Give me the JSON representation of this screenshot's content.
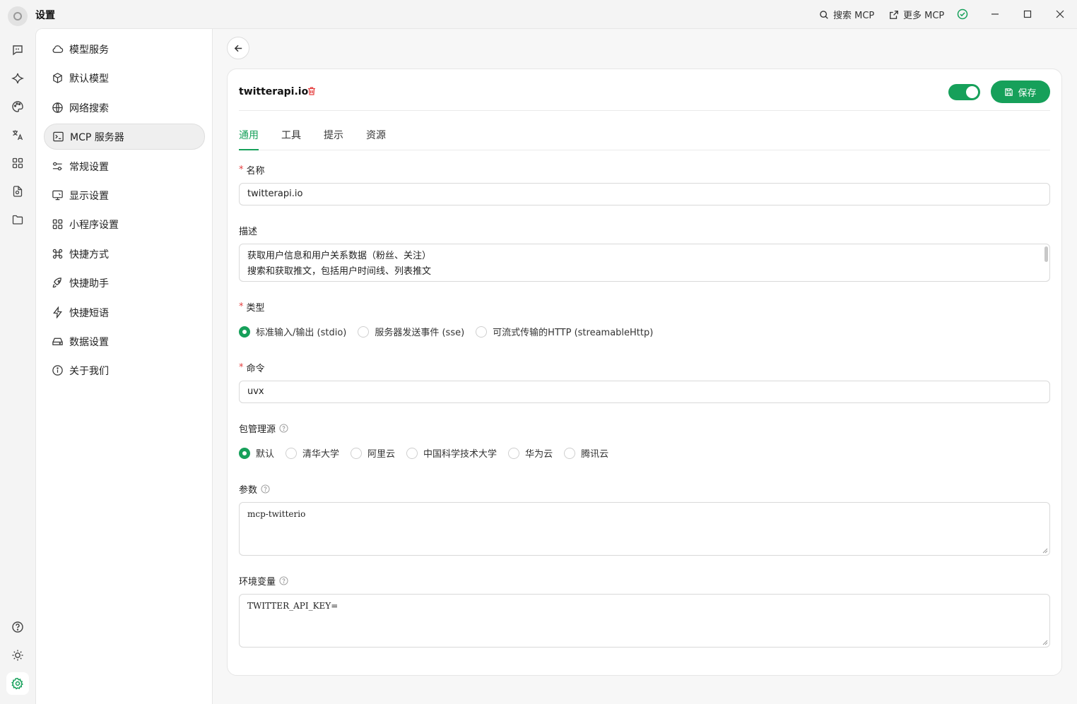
{
  "window": {
    "title": "设置",
    "search_mcp": "搜索 MCP",
    "more_mcp": "更多 MCP"
  },
  "rail": {
    "icons": [
      "chat-icon",
      "sparkle-icon",
      "palette-icon",
      "translate-icon",
      "apps-grid-icon",
      "file-search-icon",
      "folder-icon",
      "help-icon",
      "sun-icon",
      "settings-icon"
    ]
  },
  "nav": {
    "items": [
      {
        "label": "模型服务",
        "icon": "cloud-icon"
      },
      {
        "label": "默认模型",
        "icon": "cube-icon"
      },
      {
        "label": "网络搜索",
        "icon": "globe-icon"
      },
      {
        "label": "MCP 服务器",
        "icon": "terminal-icon",
        "active": true
      },
      {
        "label": "常规设置",
        "icon": "sliders-icon"
      },
      {
        "label": "显示设置",
        "icon": "monitor-icon"
      },
      {
        "label": "小程序设置",
        "icon": "grid-icon"
      },
      {
        "label": "快捷方式",
        "icon": "command-icon"
      },
      {
        "label": "快捷助手",
        "icon": "rocket-icon"
      },
      {
        "label": "快捷短语",
        "icon": "zap-icon"
      },
      {
        "label": "数据设置",
        "icon": "hard-drive-icon"
      },
      {
        "label": "关于我们",
        "icon": "info-icon"
      }
    ]
  },
  "server": {
    "name": "twitterapi.io",
    "enabled": true,
    "save_label": "保存"
  },
  "tabs": [
    "通用",
    "工具",
    "提示",
    "资源"
  ],
  "form": {
    "name_label": "名称",
    "name_value": "twitterapi.io",
    "desc_label": "描述",
    "desc_line1": "获取用户信息和用户关系数据（粉丝、关注）",
    "desc_line2": "搜索和获取推文，包括用户时间线、列表推文",
    "type_label": "类型",
    "type_options": [
      "标准输入/输出 (stdio)",
      "服务器发送事件 (sse)",
      "可流式传输的HTTP (streamableHttp)"
    ],
    "type_selected": 0,
    "command_label": "命令",
    "command_value": "uvx",
    "registry_label": "包管理源",
    "registry_options": [
      "默认",
      "清华大学",
      "阿里云",
      "中国科学技术大学",
      "华为云",
      "腾讯云"
    ],
    "registry_selected": 0,
    "args_label": "参数",
    "args_value": "mcp-twitterio",
    "env_label": "环境变量",
    "env_value": "TWITTER_API_KEY="
  },
  "colors": {
    "accent": "#16a05a",
    "required": "#e54040"
  }
}
